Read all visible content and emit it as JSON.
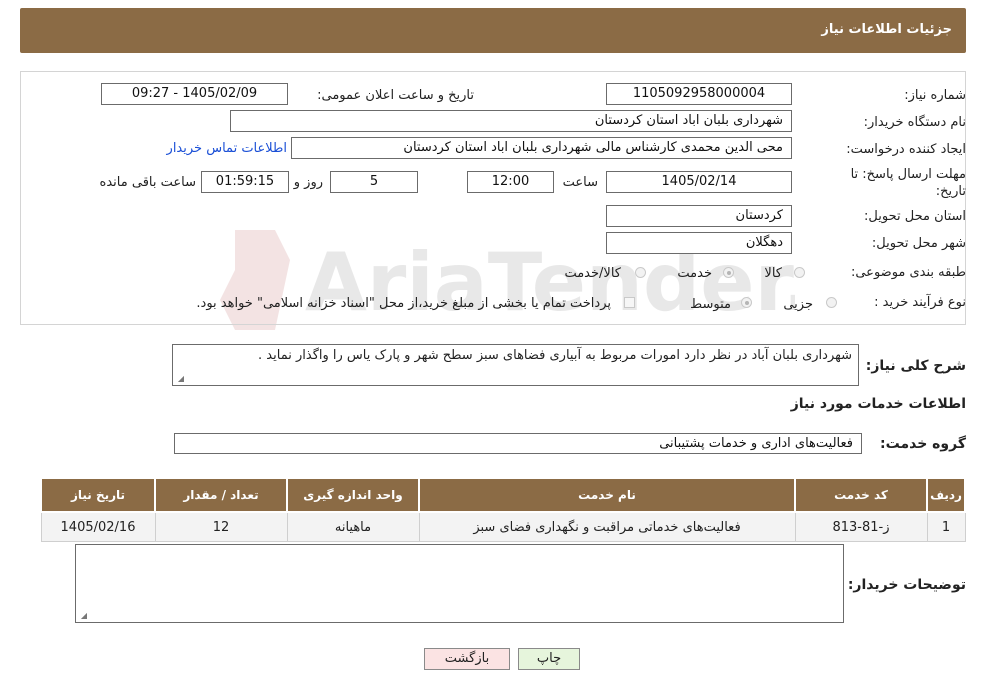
{
  "header": {
    "title": "جزئیات اطلاعات نیاز"
  },
  "form": {
    "need_number_label": "شماره نیاز:",
    "need_number": "1105092958000004",
    "announce_label": "تاریخ و ساعت اعلان عمومی:",
    "announce_value": "1405/02/09 - 09:27",
    "buyer_org_label": "نام دستگاه خریدار:",
    "buyer_org": "شهرداری بلبان اباد استان کردستان",
    "creator_label": "ایجاد کننده درخواست:",
    "creator": "محی الدین محمدی کارشناس مالی شهرداری بلبان اباد استان کردستان",
    "contact_link": "اطلاعات تماس خریدار",
    "deadline_label": "مهلت ارسال پاسخ: تا تاریخ:",
    "deadline_date": "1405/02/14",
    "time_label": "ساعت",
    "deadline_time": "12:00",
    "days_value": "5",
    "days_label": "روز و",
    "remaining_time": "01:59:15",
    "remaining_label": "ساعت باقی مانده",
    "province_label": "استان محل تحویل:",
    "province": "کردستان",
    "city_label": "شهر محل تحویل:",
    "city": "دهگلان",
    "category_label": "طبقه بندی موضوعی:",
    "category_options": [
      "کالا",
      "خدمت",
      "کالا/خدمت"
    ],
    "process_label": "نوع فرآیند خرید :",
    "process_options": [
      "جزیی",
      "متوسط"
    ],
    "payment_note": "پرداخت تمام یا بخشی از مبلغ خرید،از محل \"اسناد خزانه اسلامی\" خواهد بود."
  },
  "summary": {
    "label": "شرح کلی نیاز:",
    "text": "شهرداری بلبان آباد در نظر دارد امورات مربوط به آبیاری فضاهای سبز سطح شهر و پارک یاس را واگذار نماید ."
  },
  "services": {
    "section_title": "اطلاعات خدمات مورد نیاز",
    "group_label": "گروه خدمت:",
    "group_value": "فعالیت‌های اداری و خدمات پشتیبانی",
    "columns": [
      "ردیف",
      "کد خدمت",
      "نام خدمت",
      "واحد اندازه گیری",
      "تعداد / مقدار",
      "تاریخ نیاز"
    ],
    "rows": [
      [
        "1",
        "ز-81-813",
        "فعالیت‌های خدماتی مراقبت و نگهداری فضای سبز",
        "ماهیانه",
        "12",
        "1405/02/16"
      ]
    ]
  },
  "buyer_notes": {
    "label": "توضیحات خریدار:",
    "text": ""
  },
  "buttons": {
    "print": "چاپ",
    "back": "بازگشت"
  },
  "watermark": {
    "text": "AriaTender.neT"
  },
  "colors": {
    "header_bg": "#8b6b45",
    "link": "#1a4fd6",
    "back_btn_bg": "#fbe3e3",
    "print_btn_bg": "#e6f5dc"
  }
}
